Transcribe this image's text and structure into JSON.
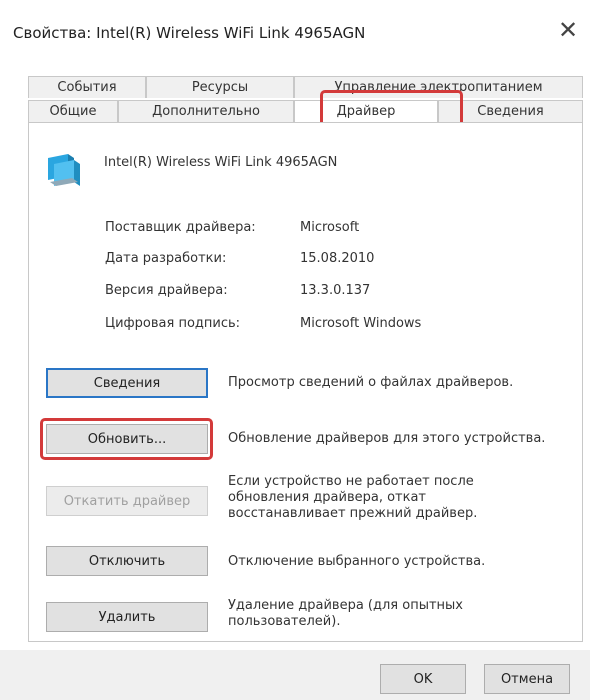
{
  "window": {
    "title": "Свойства: Intel(R) Wireless WiFi Link 4965AGN",
    "close_glyph": "✕"
  },
  "tabs": {
    "row1": [
      "События",
      "Ресурсы",
      "Управление электропитанием"
    ],
    "row2": [
      "Общие",
      "Дополнительно",
      "Драйвер",
      "Сведения"
    ],
    "active": "Драйвер"
  },
  "device": {
    "name": "Intel(R) Wireless WiFi Link 4965AGN",
    "icon": "network-adapter-icon"
  },
  "driver_info": [
    {
      "label": "Поставщик драйвера:",
      "value": "Microsoft"
    },
    {
      "label": "Дата разработки:",
      "value": "15.08.2010"
    },
    {
      "label": "Версия драйвера:",
      "value": "13.3.0.137"
    },
    {
      "label": "Цифровая подпись:",
      "value": "Microsoft Windows"
    }
  ],
  "actions": [
    {
      "button": "Сведения",
      "desc": "Просмотр сведений о файлах драйверов."
    },
    {
      "button": "Обновить...",
      "desc": "Обновление драйверов для этого устройства."
    },
    {
      "button": "Откатить драйвер",
      "desc_lines": [
        "Если устройство не работает после",
        "обновления драйвера, откат",
        "восстанавливает прежний драйвер."
      ]
    },
    {
      "button": "Отключить",
      "desc": "Отключение выбранного устройства."
    },
    {
      "button": "Удалить",
      "desc_lines": [
        "Удаление драйвера (для опытных",
        "пользователей)."
      ]
    }
  ],
  "footer": {
    "ok": "OK",
    "cancel": "Отмена"
  },
  "colors": {
    "highlight_red": "#d33a3a",
    "focus_blue": "#2a76c6"
  }
}
